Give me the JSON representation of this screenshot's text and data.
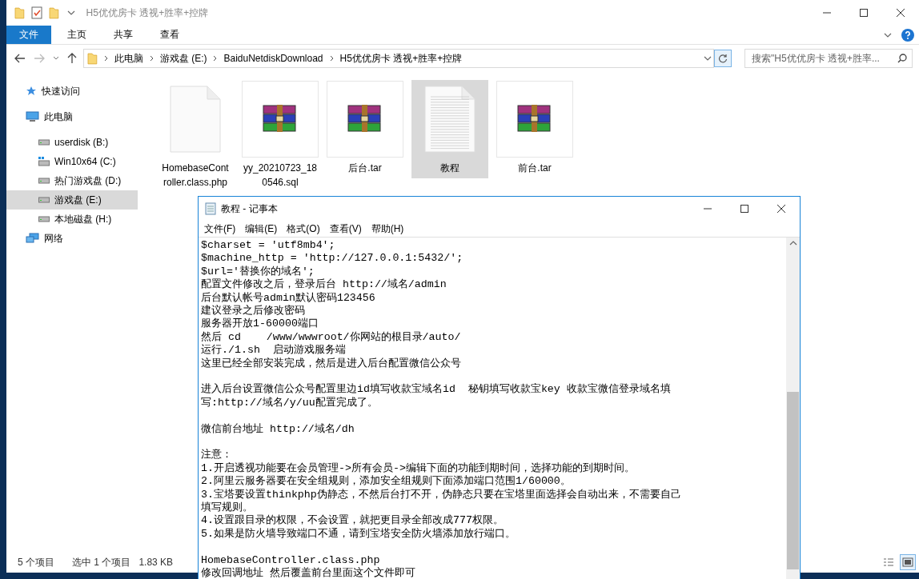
{
  "explorer": {
    "title": "H5优优房卡 透视+胜率+控牌",
    "ribbon_tabs": [
      {
        "label": "文件",
        "kind": "file"
      },
      {
        "label": "主页",
        "kind": "tab"
      },
      {
        "label": "共享",
        "kind": "tab"
      },
      {
        "label": "查看",
        "kind": "tab"
      }
    ],
    "breadcrumb": [
      "此电脑",
      "游戏盘 (E:)",
      "BaiduNetdiskDownload",
      "H5优优房卡 透视+胜率+控牌"
    ],
    "search": {
      "placeholder": "搜索\"H5优优房卡 透视+胜率..."
    },
    "sidebar": {
      "items": [
        {
          "label": "快速访问",
          "kind": "star",
          "selected": false
        },
        {
          "label": "此电脑",
          "kind": "pc",
          "selected": false,
          "children": [
            {
              "label": "userdisk (B:)",
              "kind": "drive",
              "selected": false
            },
            {
              "label": "Win10x64 (C:)",
              "kind": "windrive",
              "selected": false
            },
            {
              "label": "热门游戏盘 (D:)",
              "kind": "drive",
              "selected": false
            },
            {
              "label": "游戏盘 (E:)",
              "kind": "drive",
              "selected": true
            },
            {
              "label": "本地磁盘 (H:)",
              "kind": "drive",
              "selected": false
            }
          ]
        },
        {
          "label": "网络",
          "kind": "network",
          "selected": false
        }
      ]
    },
    "files": [
      {
        "label": [
          "HomebaseCont",
          "roller.class.php"
        ],
        "kind": "blank",
        "selected": false
      },
      {
        "label": [
          "yy_20210723_18",
          "0546.sql"
        ],
        "kind": "archive",
        "selected": false
      },
      {
        "label": [
          "后台.tar"
        ],
        "kind": "archive",
        "selected": false
      },
      {
        "label": [
          "教程"
        ],
        "kind": "text",
        "selected": true
      },
      {
        "label": [
          "前台.tar"
        ],
        "kind": "archive",
        "selected": false
      }
    ],
    "status_bar": {
      "count": "5 个项目",
      "selection": "选中 1 个项目",
      "size": "1.83 KB"
    }
  },
  "notepad": {
    "title": "教程 - 记事本",
    "menu": [
      "文件(F)",
      "编辑(E)",
      "格式(O)",
      "查看(V)",
      "帮助(H)"
    ],
    "blocks": [
      [
        "$charset = 'utf8mb4';",
        "$machine_http = 'http://127.0.0.1:5432/';",
        "$url='替换你的域名';",
        "配置文件修改之后，登录后台 http://域名/admin",
        "后台默认帐号admin默认密码123456",
        "建议登录之后修改密码",
        "服务器开放1-60000端口",
        "然后 cd    /www/wwwroot/你网站的根目录/auto/",
        "运行./1.sh  启动游戏服务端",
        "这里已经全部安装完成，然后是进入后台配置微信公众号"
      ],
      [
        "进入后台设置微信公众号配置里边id填写收款宝域名id  秘钥填写收款宝key 收款宝微信登录域名填",
        "写:http://域名/y/uu配置完成了。"
      ],
      [
        "微信前台地址 http://域名/dh"
      ],
      [
        "注意：",
        "1.开启透视功能要在会员管理->所有会员->编辑下面的功能到期时间，选择功能的到期时间。",
        "2.阿里云服务器要在安全组规则，添加安全组规则下面添加端口范围1/60000。",
        "3.宝塔要设置thinkphp伪静态，不然后台打不开，伪静态只要在宝塔里面选择会自动出来，不需要自己",
        "填写规则。",
        "4.设置跟目录的权限，不会设置，就把更目录全部改成777权限。",
        "5.如果是防火墙导致端口不通，请到宝塔安全防火墙添加放行端口。"
      ],
      [
        "HomebaseController.class.php",
        "修改回调地址 然后覆盖前台里面这个文件即可"
      ]
    ]
  }
}
